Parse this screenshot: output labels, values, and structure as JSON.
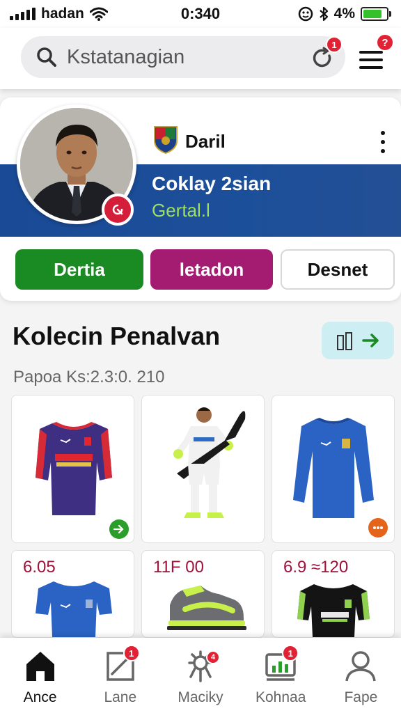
{
  "status_bar": {
    "carrier": "hadan",
    "time": "0:340",
    "battery": "4%"
  },
  "search": {
    "text": "Kstatanagian",
    "refresh_badge": "1",
    "menu_badge": "?"
  },
  "profile": {
    "name": "Daril",
    "banner_title": "Coklay 2sian",
    "banner_subtitle": "Gertal.l",
    "buttons": [
      "Dertia",
      "letadon",
      "Desnet"
    ]
  },
  "section": {
    "title": "Kolecin Penalvan",
    "meta": "Papoa Ks:2.3:0. 210"
  },
  "products": [
    {
      "name": "purple-jersey",
      "price": ""
    },
    {
      "name": "player-figure",
      "price": ""
    },
    {
      "name": "blue-long-sleeve-jersey",
      "price": ""
    },
    {
      "name": "blue-jersey",
      "price": "6.05"
    },
    {
      "name": "sneaker",
      "price": "11F 00"
    },
    {
      "name": "black-jersey",
      "price": "6.9 ≈120"
    }
  ],
  "bottom_nav": {
    "items": [
      {
        "label": "Ance",
        "icon": "home-icon",
        "badge": ""
      },
      {
        "label": "Lane",
        "icon": "edit-icon",
        "badge": "1"
      },
      {
        "label": "Maciky",
        "icon": "gear-icon",
        "badge": "4"
      },
      {
        "label": "Kohnaa",
        "icon": "chart-icon",
        "badge": "1"
      },
      {
        "label": "Fape",
        "icon": "user-icon",
        "badge": ""
      }
    ]
  },
  "colors": {
    "banner": "#1a4a95",
    "primary_green": "#1a8a22",
    "magenta": "#a41b72",
    "price": "#a0123c",
    "badge": "#e02234"
  }
}
